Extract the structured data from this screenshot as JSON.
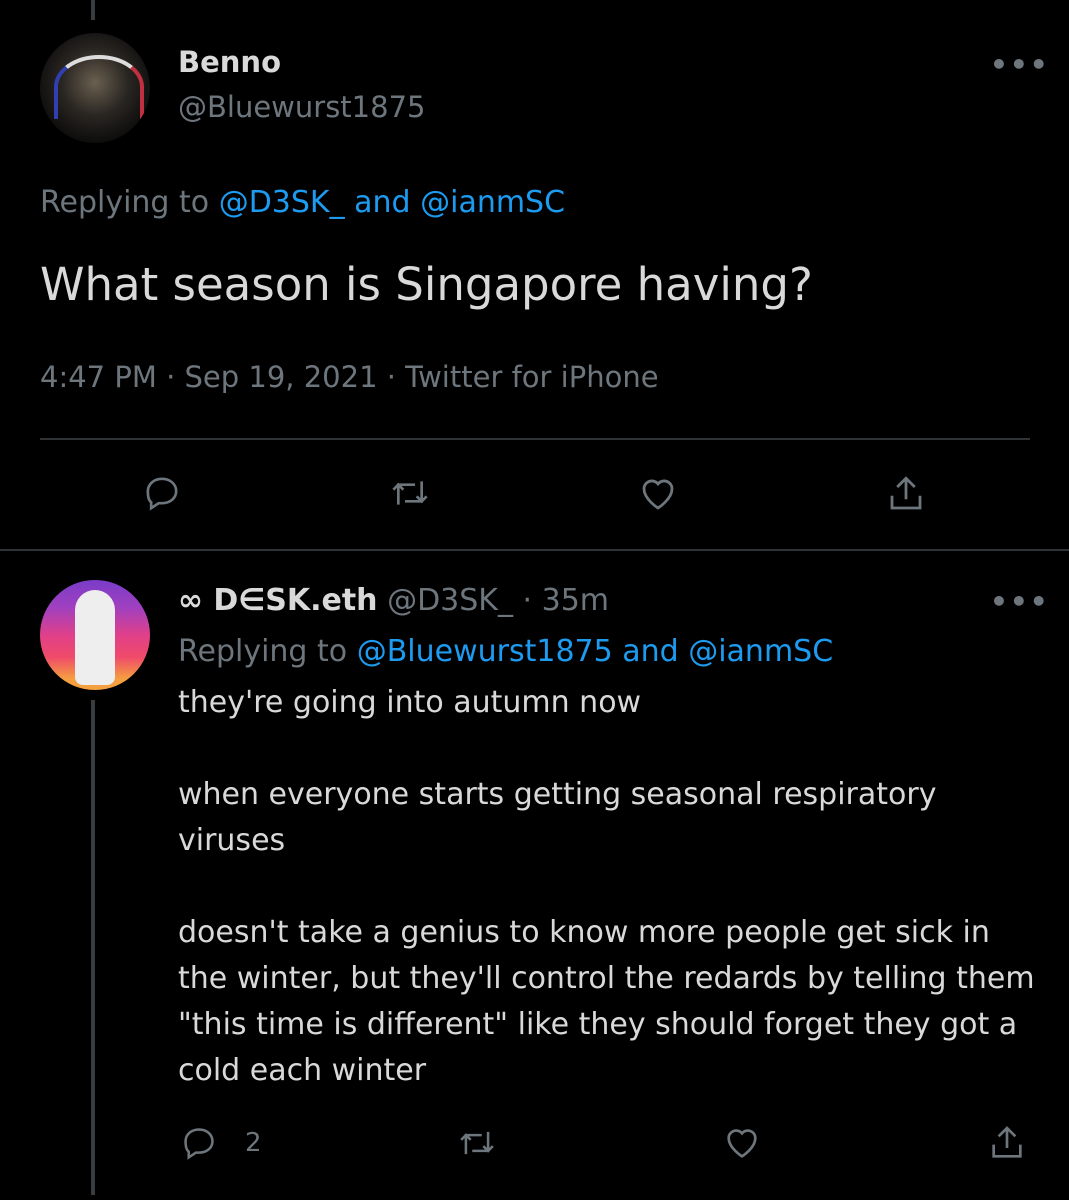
{
  "main_tweet": {
    "name": "Benno",
    "handle": "@Bluewurst1875",
    "replying_prefix": "Replying to",
    "replying_to": "@D3SK_ and @ianmSC",
    "text": "What season is Singapore having?",
    "timestamp": "4:47 PM · Sep 19, 2021 · Twitter for iPhone"
  },
  "reply_tweet": {
    "name": "∞ D∈SK.eth",
    "handle": "@D3SK_",
    "time": "· 35m",
    "replying_prefix": "Replying to",
    "replying_to": "@Bluewurst1875 and @ianmSC",
    "lines": [
      "they're going into autumn now",
      "when everyone starts getting seasonal respiratory",
      "viruses",
      "doesn't take a genius to know more people get sick in",
      "the winter, but they'll control the redards by telling them",
      "\"this time is different\" like they should forget they got a",
      "cold each winter"
    ],
    "reply_count": "2"
  },
  "more_glyph": "•••",
  "colors": {
    "accent": "#1d9bf0",
    "secondary": "#6e767d",
    "text": "#d9d9d9"
  }
}
